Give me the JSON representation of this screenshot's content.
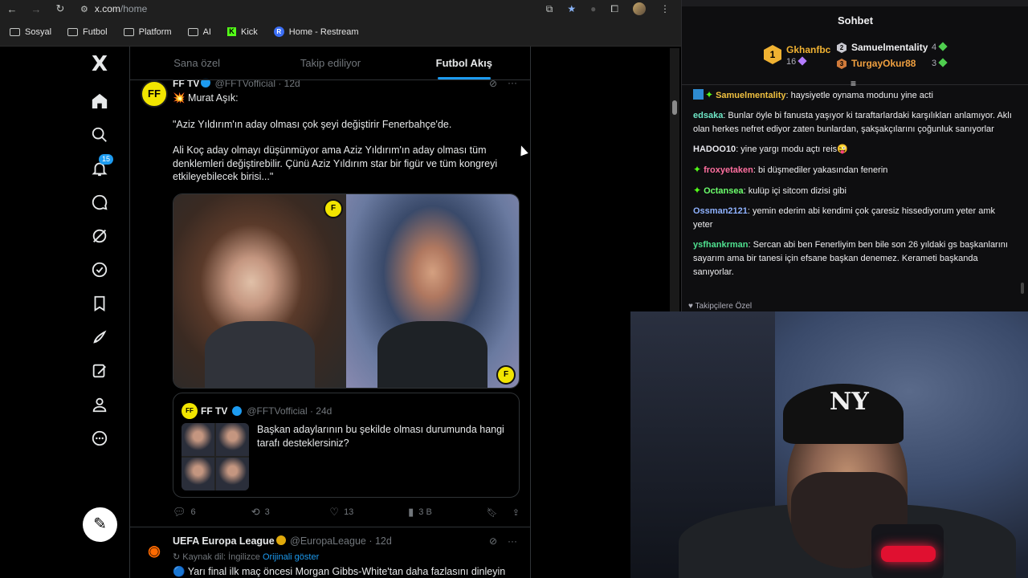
{
  "browser": {
    "url_site": "x.com",
    "url_path": "/home",
    "bookmarks": [
      {
        "label": "Sosyal",
        "icon": "folder-icon"
      },
      {
        "label": "Futbol",
        "icon": "folder-icon"
      },
      {
        "label": "Platform",
        "icon": "folder-icon"
      },
      {
        "label": "AI",
        "icon": "folder-icon"
      },
      {
        "label": "Kick",
        "icon": "kick-icon"
      },
      {
        "label": "Home - Restream",
        "icon": "restream-icon"
      }
    ]
  },
  "nav": {
    "logo": "X",
    "notifications_count": "15",
    "items": [
      "home-icon",
      "search-icon",
      "bell-icon",
      "chat-icon",
      "grok-icon",
      "verified-icon",
      "bookmark-icon",
      "rocket-icon",
      "edit-icon",
      "profile-icon",
      "more-icon"
    ]
  },
  "feed": {
    "tabs": [
      {
        "label": "Sana özel",
        "active": false
      },
      {
        "label": "Takip ediliyor",
        "active": false
      },
      {
        "label": "Futbol Akış",
        "active": true
      }
    ],
    "post1": {
      "name": "FF TV",
      "handle": "@FFTVofficial · 12d",
      "avatar_text": "FF",
      "lines": [
        "💥 Murat Aşık:",
        "\"Aziz Yıldırım'ın aday olması çok şeyi değiştirir Fenerbahçe'de.",
        "Ali Koç aday olmayı düşünmüyor ama Aziz Yıldırım'ın aday olması tüm denklemleri değiştirebilir. Çünü Aziz Yıldırım star bir figür ve tüm kongreyi etkileyebilecek birisi...\""
      ],
      "quote": {
        "name": "FF TV",
        "handle": "@FFTVofficial · 24d",
        "text": "Başkan adaylarının bu şekilde olması durumunda hangi tarafı desteklersiniz?"
      },
      "actions": {
        "replies": "6",
        "reposts": "3",
        "likes": "13",
        "views": "3 B"
      }
    },
    "post2": {
      "name": "UEFA Europa League",
      "handle": "@EuropaLeague · 12d",
      "source": "Kaynak dil: İngilizce",
      "show_original": "Orijinali göster",
      "text": "🔵 Yarı final ilk maç öncesi Morgan Gibbs-White'tan daha fazlasını dinleyin"
    }
  },
  "chat": {
    "title": "Sohbet",
    "leaderboard": {
      "first": {
        "rank": "1",
        "name": "Gkhanfbc",
        "count": "16"
      },
      "second": {
        "rank": "2",
        "name": "Samuelmentality",
        "count": "4"
      },
      "third": {
        "rank": "3",
        "name": "TurgayOkur88",
        "count": "3"
      }
    },
    "messages": [
      {
        "user": "Samuelmentality",
        "color": "#f0c040",
        "text": " haysiyetle oynama modunu yine acti",
        "badges": true
      },
      {
        "user": "edsaka",
        "color": "#6fe8c8",
        "text": " Bunlar öyle bi fanusta yaşıyor ki taraftarlardaki karşılıkları anlamıyor. Aklı olan herkes nefret ediyor zaten bunlardan, şakşakçılarını çoğunluk sanıyorlar",
        "badges": false
      },
      {
        "user": "HADOO10",
        "color": "#e8e8ee",
        "text": " yine yargı modu açtı reis😜",
        "badges": false
      },
      {
        "user": "froxyetaken",
        "color": "#ff6f9f",
        "text": " bi düşmediler yakasından fenerin",
        "badges": true
      },
      {
        "user": "Octansea",
        "color": "#6cff6c",
        "text": " kulüp içi sitcom dizisi gibi",
        "badges": true
      },
      {
        "user": "Ossman2121",
        "color": "#8fb2ff",
        "text": " yemin ederim abi kendimi çok çaresiz hissediyorum yeter amk yeter",
        "badges": false
      },
      {
        "user": "ysfhankrman",
        "color": "#4fe08f",
        "text": " Sercan abi ben Fenerliyim ben bile son 26 yıldaki gs başkanlarını sayarım ama bir tanesi için efsane başkan denemez. Kerameti başkanda sanıyorlar.",
        "badges": false
      }
    ],
    "footer": "Takipçilere Özel"
  },
  "webcam": {
    "cap_logo": "NY"
  }
}
